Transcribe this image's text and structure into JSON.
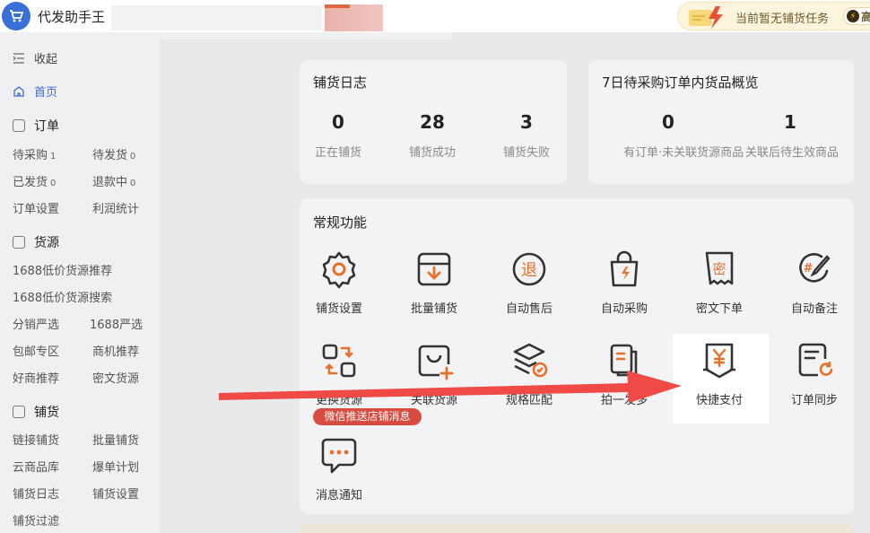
{
  "header": {
    "app_title": "代发助手王",
    "task_status": "当前暂无铺货任务",
    "badge_char": "高"
  },
  "sidebar": {
    "collapse": "收起",
    "home": "首页",
    "groups": {
      "orders": "订单",
      "source": "货源",
      "distribution": "铺货"
    },
    "order_links": [
      {
        "label": "待采购",
        "count": "1"
      },
      {
        "label": "待发货",
        "count": "0"
      },
      {
        "label": "已发货",
        "count": "0"
      },
      {
        "label": "退款中",
        "count": "0"
      },
      {
        "label": "订单设置",
        "count": ""
      },
      {
        "label": "利润统计",
        "count": ""
      }
    ],
    "source_links": [
      "1688低价货源推荐",
      "1688低价货源搜索",
      "分销严选",
      "1688严选",
      "包邮专区",
      "商机推荐",
      "好商推荐",
      "密文货源"
    ],
    "distribution_links": [
      "链接铺货",
      "批量铺货",
      "云商品库",
      "爆单计划",
      "铺货日志",
      "铺货设置",
      "铺货过滤"
    ]
  },
  "log_card": {
    "title": "铺货日志",
    "stats": [
      {
        "value": "0",
        "label": "正在铺货"
      },
      {
        "value": "28",
        "label": "铺货成功"
      },
      {
        "value": "3",
        "label": "铺货失败"
      }
    ]
  },
  "overview_card": {
    "title": "7日待采购订单内货品概览",
    "stats": [
      {
        "value": "0",
        "label": "有订单·未关联货源商品"
      },
      {
        "value": "1",
        "label": "关联后待生效商品"
      }
    ]
  },
  "features": {
    "title": "常规功能",
    "row1": [
      {
        "label": "铺货设置",
        "icon": "gear-icon"
      },
      {
        "label": "批量铺货",
        "icon": "inbox-download-icon"
      },
      {
        "label": "自动售后",
        "icon": "refund-icon"
      },
      {
        "label": "自动采购",
        "icon": "shopping-bag-icon"
      },
      {
        "label": "密文下单",
        "icon": "cipher-icon"
      },
      {
        "label": "自动备注",
        "icon": "note-edit-icon"
      }
    ],
    "row2": [
      {
        "label": "更换货源",
        "icon": "swap-icon"
      },
      {
        "label": "关联货源",
        "icon": "link-source-icon"
      },
      {
        "label": "规格匹配",
        "icon": "layers-check-icon"
      },
      {
        "label": "拍一发多",
        "icon": "copy-pages-icon"
      },
      {
        "label": "快捷支付",
        "icon": "yuan-pay-icon"
      },
      {
        "label": "订单同步",
        "icon": "order-sync-icon"
      }
    ],
    "row3": [
      {
        "label": "消息通知",
        "icon": "chat-icon"
      }
    ],
    "wechat_badge": "微信推送店铺消息"
  },
  "colors": {
    "accent_blue": "#3b6bdc",
    "icon_orange": "#e8712a",
    "arrow_red": "#ef4a45",
    "badge_red": "#d94a3f"
  }
}
